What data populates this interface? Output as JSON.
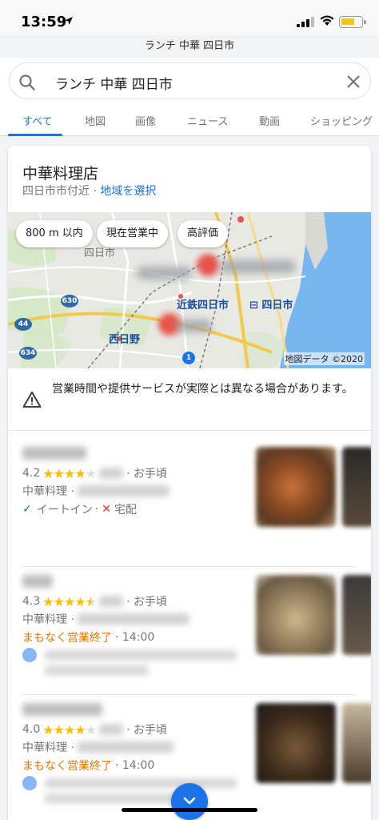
{
  "status_bar": {
    "time": "13:59",
    "url": "ランチ 中華 四日市"
  },
  "search": {
    "query": "ランチ 中華 四日市"
  },
  "tabs": [
    {
      "label": "すべて",
      "active": true
    },
    {
      "label": "地図",
      "active": false
    },
    {
      "label": "画像",
      "active": false
    },
    {
      "label": "ニュース",
      "active": false
    },
    {
      "label": "動画",
      "active": false
    },
    {
      "label": "ショッピング",
      "active": false
    }
  ],
  "card": {
    "title": "中華料理店",
    "subtitle_prefix": "四日市市付近 · ",
    "subtitle_link": "地域を選択"
  },
  "map": {
    "chips": [
      "800 m 以内",
      "現在営業中",
      "高評価"
    ],
    "labels": {
      "city": "四日市",
      "station1": "近鉄四日市",
      "station2": "四日市",
      "station3": "西日野"
    },
    "routes": [
      "630",
      "44",
      "634",
      "1"
    ],
    "copyright": "地図データ ©2020"
  },
  "warning": {
    "text": "営業時間や提供サービスが実際とは異なる場合があります。"
  },
  "listings": [
    {
      "rating": "4.2",
      "stars_full": 4,
      "stars_half": false,
      "price": "· お手頃",
      "category": "中華料理 ·",
      "services": {
        "dine_in": "イートイン",
        "sep": "·",
        "delivery": "宅配"
      }
    },
    {
      "rating": "4.3",
      "stars_full": 4,
      "stars_half": true,
      "price": "· お手頃",
      "category": "中華料理 ·",
      "status": "まもなく営業終了",
      "close_time": "· 14:00"
    },
    {
      "rating": "4.0",
      "stars_full": 4,
      "stars_half": false,
      "price": "· お手頃",
      "category": "中華料理 ·",
      "status": "まもなく営業終了",
      "close_time": "· 14:00"
    }
  ],
  "colors": {
    "accent": "#1a73e8",
    "star": "#fbbc04",
    "closing": "#e37400",
    "check": "#188038",
    "cross": "#d93025"
  },
  "icons": [
    "location-arrow-icon",
    "signal-icon",
    "wifi-icon",
    "battery-icon",
    "search-icon",
    "close-icon",
    "warning-icon",
    "check-icon",
    "cross-icon",
    "avatar-icon",
    "chevron-down-icon"
  ]
}
